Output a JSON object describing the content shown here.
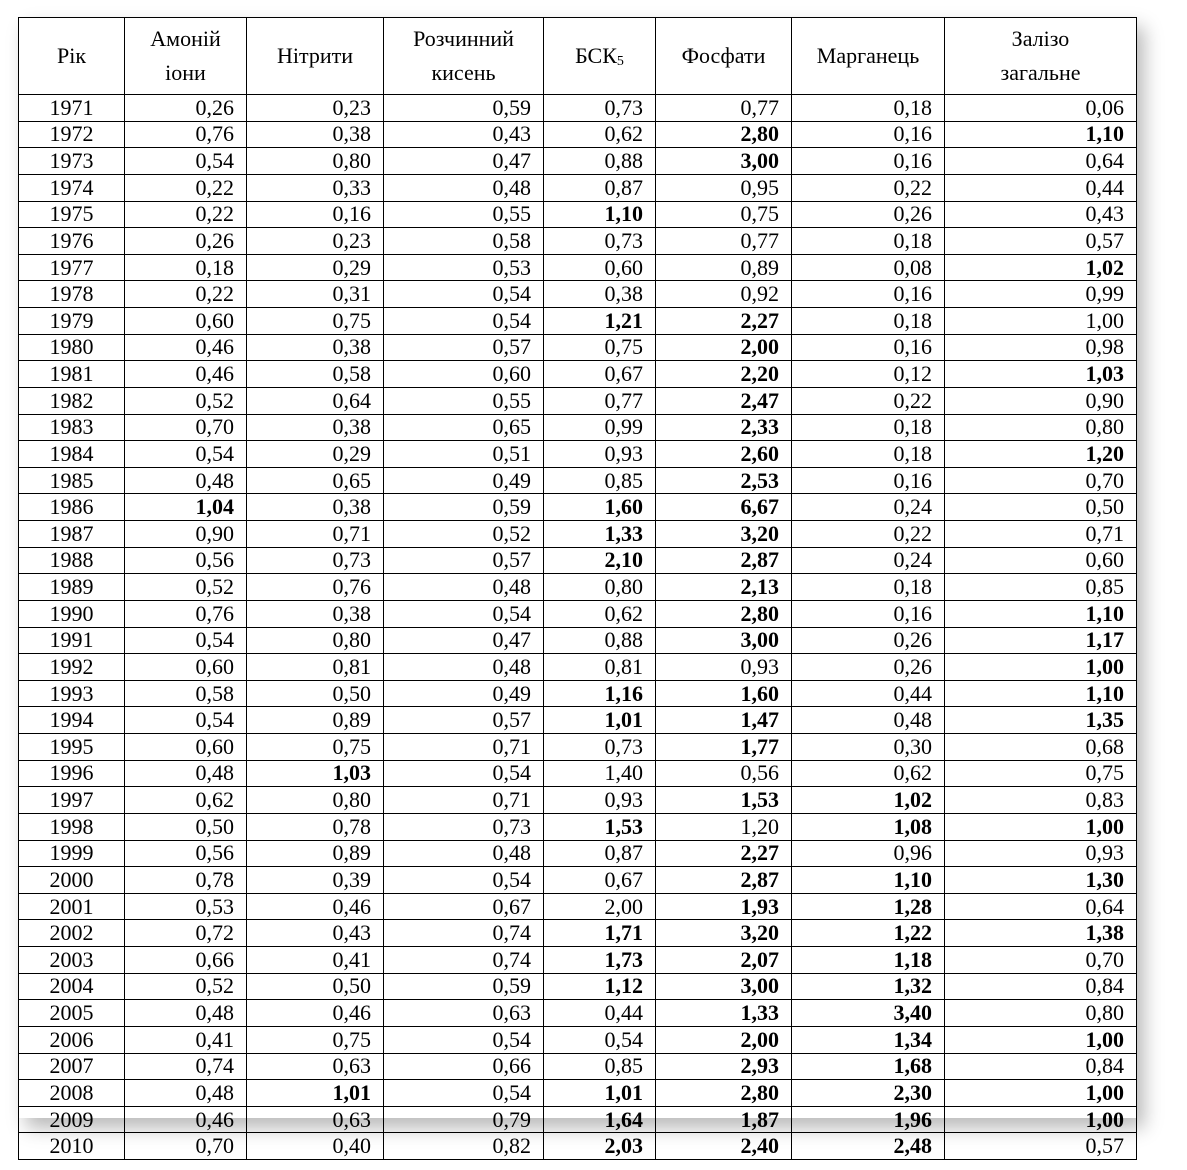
{
  "table": {
    "headers": [
      {
        "line1": "Рік",
        "line2": ""
      },
      {
        "line1": "Амоній",
        "line2": "іони"
      },
      {
        "line1": "Нітрити",
        "line2": ""
      },
      {
        "line1": "Розчинний",
        "line2": "кисень"
      },
      {
        "line1": "БСК",
        "line2": "",
        "sub": "5"
      },
      {
        "line1": "Фосфати",
        "line2": ""
      },
      {
        "line1": "Марганець",
        "line2": ""
      },
      {
        "line1": "Залізо",
        "line2": "загальне"
      }
    ],
    "rows": [
      [
        "1971",
        "0,26",
        "0,23",
        "0,59",
        "0,73",
        "0,77",
        "0,18",
        "0,06"
      ],
      [
        "1972",
        "0,76",
        "0,38",
        "0,43",
        "0,62",
        "2,80",
        "0,16",
        "1,10"
      ],
      [
        "1973",
        "0,54",
        "0,80",
        "0,47",
        "0,88",
        "3,00",
        "0,16",
        "0,64"
      ],
      [
        "1974",
        "0,22",
        "0,33",
        "0,48",
        "0,87",
        "0,95",
        "0,22",
        "0,44"
      ],
      [
        "1975",
        "0,22",
        "0,16",
        "0,55",
        "1,10",
        "0,75",
        "0,26",
        "0,43"
      ],
      [
        "1976",
        "0,26",
        "0,23",
        "0,58",
        "0,73",
        "0,77",
        "0,18",
        "0,57"
      ],
      [
        "1977",
        "0,18",
        "0,29",
        "0,53",
        "0,60",
        "0,89",
        "0,08",
        "1,02"
      ],
      [
        "1978",
        "0,22",
        "0,31",
        "0,54",
        "0,38",
        "0,92",
        "0,16",
        "0,99"
      ],
      [
        "1979",
        "0,60",
        "0,75",
        "0,54",
        "1,21",
        "2,27",
        "0,18",
        "1,00"
      ],
      [
        "1980",
        "0,46",
        "0,38",
        "0,57",
        "0,75",
        "2,00",
        "0,16",
        "0,98"
      ],
      [
        "1981",
        "0,46",
        "0,58",
        "0,60",
        "0,67",
        "2,20",
        "0,12",
        "1,03"
      ],
      [
        "1982",
        "0,52",
        "0,64",
        "0,55",
        "0,77",
        "2,47",
        "0,22",
        "0,90"
      ],
      [
        "1983",
        "0,70",
        "0,38",
        "0,65",
        "0,99",
        "2,33",
        "0,18",
        "0,80"
      ],
      [
        "1984",
        "0,54",
        "0,29",
        "0,51",
        "0,93",
        "2,60",
        "0,18",
        "1,20"
      ],
      [
        "1985",
        "0,48",
        "0,65",
        "0,49",
        "0,85",
        "2,53",
        "0,16",
        "0,70"
      ],
      [
        "1986",
        "1,04",
        "0,38",
        "0,59",
        "1,60",
        "6,67",
        "0,24",
        "0,50"
      ],
      [
        "1987",
        "0,90",
        "0,71",
        "0,52",
        "1,33",
        "3,20",
        "0,22",
        "0,71"
      ],
      [
        "1988",
        "0,56",
        "0,73",
        "0,57",
        "2,10",
        "2,87",
        "0,24",
        "0,60"
      ],
      [
        "1989",
        "0,52",
        "0,76",
        "0,48",
        "0,80",
        "2,13",
        "0,18",
        "0,85"
      ],
      [
        "1990",
        "0,76",
        "0,38",
        "0,54",
        "0,62",
        "2,80",
        "0,16",
        "1,10"
      ],
      [
        "1991",
        "0,54",
        "0,80",
        "0,47",
        "0,88",
        "3,00",
        "0,26",
        "1,17"
      ],
      [
        "1992",
        "0,60",
        "0,81",
        "0,48",
        "0,81",
        "0,93",
        "0,26",
        "1,00"
      ],
      [
        "1993",
        "0,58",
        "0,50",
        "0,49",
        "1,16",
        "1,60",
        "0,44",
        "1,10"
      ],
      [
        "1994",
        "0,54",
        "0,89",
        "0,57",
        "1,01",
        "1,47",
        "0,48",
        "1,35"
      ],
      [
        "1995",
        "0,60",
        "0,75",
        "0,71",
        "0,73",
        "1,77",
        "0,30",
        "0,68"
      ],
      [
        "1996",
        "0,48",
        "1,03",
        "0,54",
        "1,40",
        "0,56",
        "0,62",
        "0,75"
      ],
      [
        "1997",
        "0,62",
        "0,80",
        "0,71",
        "0,93",
        "1,53",
        "1,02",
        "0,83"
      ],
      [
        "1998",
        "0,50",
        "0,78",
        "0,73",
        "1,53",
        "1,20",
        "1,08",
        "1,00"
      ],
      [
        "1999",
        "0,56",
        "0,89",
        "0,48",
        "0,87",
        "2,27",
        "0,96",
        "0,93"
      ],
      [
        "2000",
        "0,78",
        "0,39",
        "0,54",
        "0,67",
        "2,87",
        "1,10",
        "1,30"
      ],
      [
        "2001",
        "0,53",
        "0,46",
        "0,67",
        "2,00",
        "1,93",
        "1,28",
        "0,64"
      ],
      [
        "2002",
        "0,72",
        "0,43",
        "0,74",
        "1,71",
        "3,20",
        "1,22",
        "1,38"
      ],
      [
        "2003",
        "0,66",
        "0,41",
        "0,74",
        "1,73",
        "2,07",
        "1,18",
        "0,70"
      ],
      [
        "2004",
        "0,52",
        "0,50",
        "0,59",
        "1,12",
        "3,00",
        "1,32",
        "0,84"
      ],
      [
        "2005",
        "0,48",
        "0,46",
        "0,63",
        "0,44",
        "1,33",
        "3,40",
        "0,80"
      ],
      [
        "2006",
        "0,41",
        "0,75",
        "0,54",
        "0,54",
        "2,00",
        "1,34",
        "1,00"
      ],
      [
        "2007",
        "0,74",
        "0,63",
        "0,66",
        "0,85",
        "2,93",
        "1,68",
        "0,84"
      ],
      [
        "2008",
        "0,48",
        "1,01",
        "0,54",
        "1,01",
        "2,80",
        "2,30",
        "1,00"
      ],
      [
        "2009",
        "0,46",
        "0,63",
        "0,79",
        "1,64",
        "1,87",
        "1,96",
        "1,00"
      ],
      [
        "2010",
        "0,70",
        "0,40",
        "0,82",
        "2,03",
        "2,40",
        "2,48",
        "0,57"
      ]
    ],
    "bold": [
      [],
      [
        5,
        7
      ],
      [
        5
      ],
      [],
      [
        4
      ],
      [],
      [
        7
      ],
      [],
      [
        4,
        5
      ],
      [
        5
      ],
      [
        5,
        7
      ],
      [
        5
      ],
      [
        5
      ],
      [
        5,
        7
      ],
      [
        5
      ],
      [
        1,
        4,
        5
      ],
      [
        4,
        5
      ],
      [
        4,
        5
      ],
      [
        5
      ],
      [
        5,
        7
      ],
      [
        5,
        7
      ],
      [
        7
      ],
      [
        4,
        5,
        7
      ],
      [
        4,
        5,
        7
      ],
      [
        5
      ],
      [
        2
      ],
      [
        5,
        6
      ],
      [
        4,
        6,
        7
      ],
      [
        5
      ],
      [
        5,
        6,
        7
      ],
      [
        5,
        6
      ],
      [
        4,
        5,
        6,
        7
      ],
      [
        4,
        5,
        6
      ],
      [
        4,
        5,
        6
      ],
      [
        5,
        6
      ],
      [
        5,
        6,
        7
      ],
      [
        5,
        6
      ],
      [
        2,
        4,
        5,
        6,
        7
      ],
      [
        4,
        5,
        6,
        7
      ],
      [
        4,
        5,
        6
      ]
    ]
  }
}
